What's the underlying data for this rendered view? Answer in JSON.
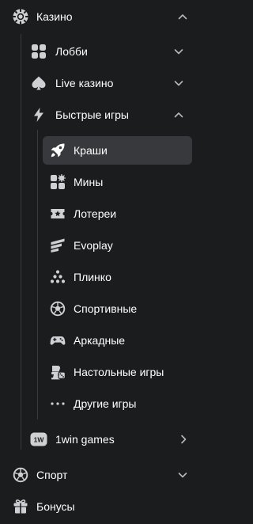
{
  "sidebar": {
    "casino": {
      "label": "Казино",
      "icon": "casino-chip-icon",
      "expanded": true
    },
    "sections": [
      {
        "label": "Лобби",
        "icon": "lobby-grid-icon",
        "chevron": "down"
      },
      {
        "label": "Live казино",
        "icon": "spade-icon",
        "chevron": "down"
      },
      {
        "label": "Быстрые игры",
        "icon": "lightning-icon",
        "chevron": "up"
      }
    ],
    "fast_games": [
      {
        "label": "Краши",
        "icon": "rocket-icon",
        "active": true
      },
      {
        "label": "Мины",
        "icon": "mines-icon",
        "active": false
      },
      {
        "label": "Лотереи",
        "icon": "lottery-ticket-icon",
        "active": false
      },
      {
        "label": "Evoplay",
        "icon": "evoplay-icon",
        "active": false
      },
      {
        "label": "Плинко",
        "icon": "plinko-icon",
        "active": false
      },
      {
        "label": "Спортивные",
        "icon": "soccer-ball-icon",
        "active": false
      },
      {
        "label": "Аркадные",
        "icon": "gamepad-icon",
        "active": false
      },
      {
        "label": "Настольные игры",
        "icon": "board-games-icon",
        "active": false
      },
      {
        "label": "Другие игры",
        "icon": "more-dots-icon",
        "active": false
      }
    ],
    "win_games": {
      "label": "1win games",
      "badge": "1W",
      "chevron": "right"
    },
    "sport": {
      "label": "Спорт",
      "icon": "soccer-ball-icon",
      "chevron": "down"
    },
    "bonuses": {
      "label": "Бонусы",
      "icon": "gift-icon"
    }
  },
  "colors": {
    "background": "#1b1c1e",
    "active_item": "#38393c",
    "tree_line": "#3a3b3e",
    "icon": "#d3d4d6",
    "chevron": "#b7b8bb",
    "text": "#ffffff"
  }
}
